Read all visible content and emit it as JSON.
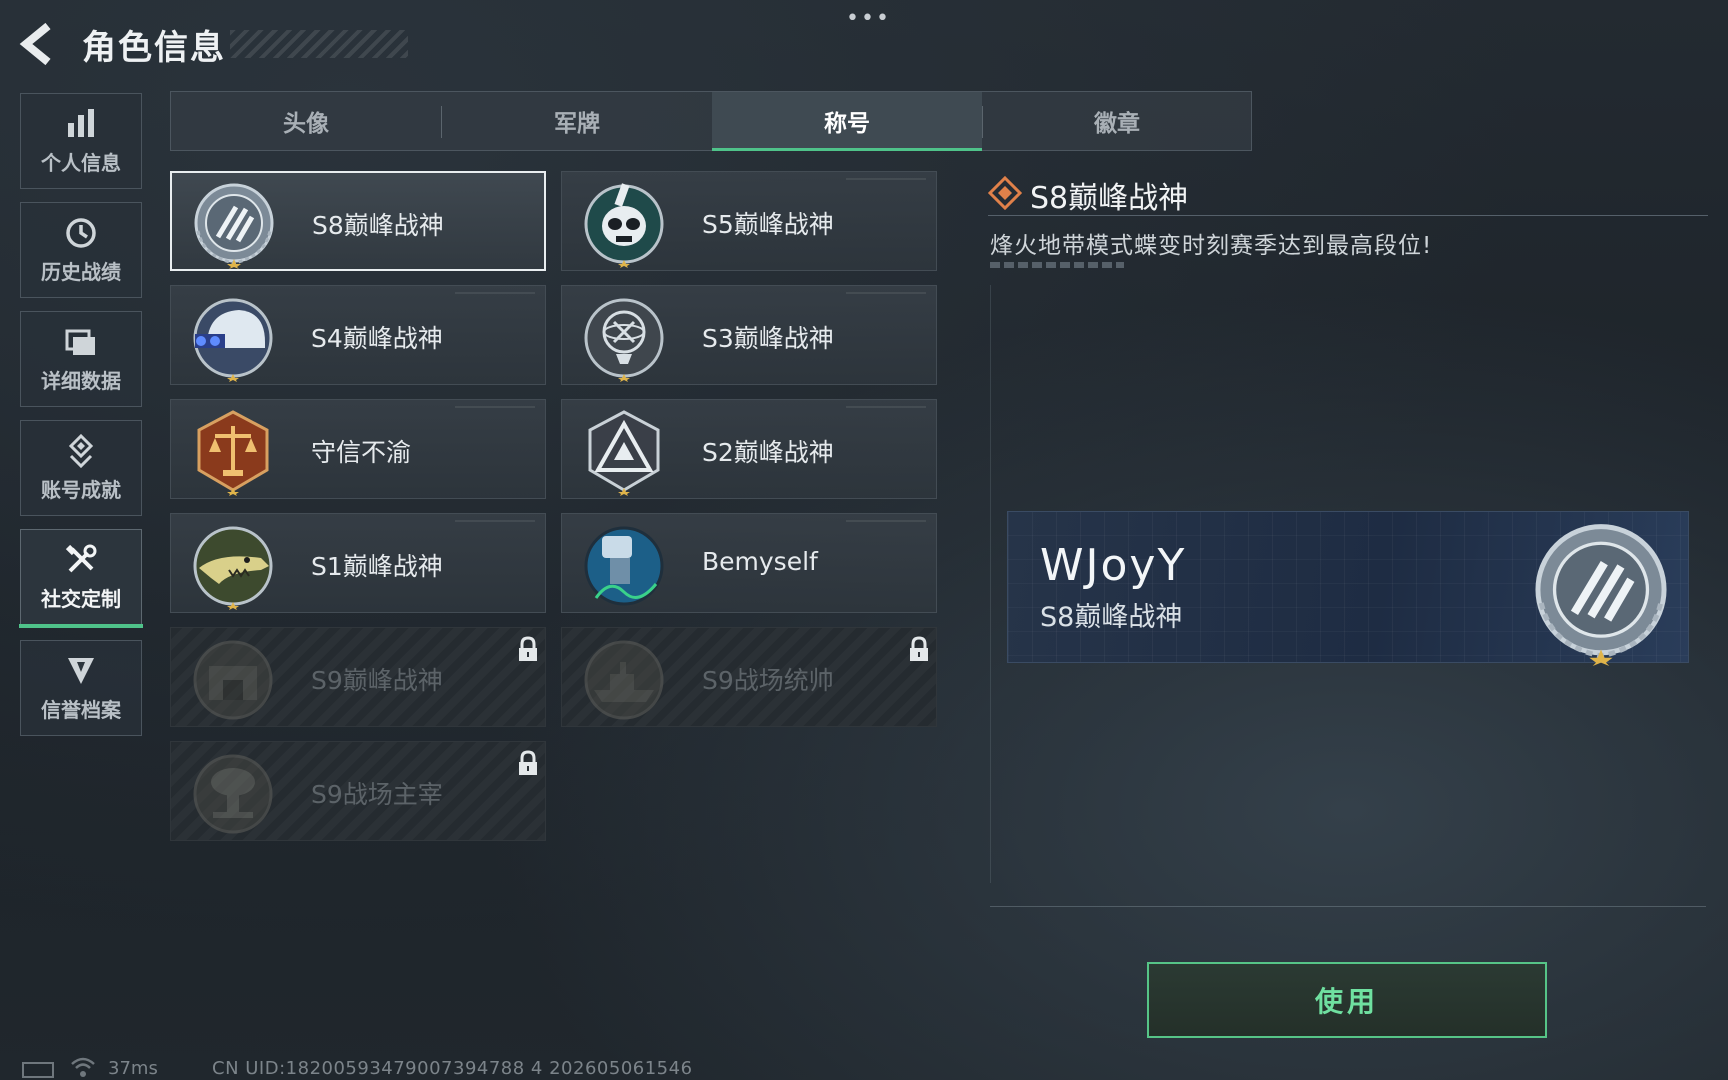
{
  "header": {
    "title": "角色信息",
    "more_glyph": "•••"
  },
  "sidebar": {
    "items": [
      {
        "label": "个人信息",
        "icon": "bar-chart-icon"
      },
      {
        "label": "历史战绩",
        "icon": "history-clock-icon"
      },
      {
        "label": "详细数据",
        "icon": "folder-icon"
      },
      {
        "label": "账号成就",
        "icon": "achievement-icon"
      },
      {
        "label": "社交定制",
        "icon": "tools-icon",
        "active": true
      },
      {
        "label": "信誉档案",
        "icon": "shield-icon"
      }
    ]
  },
  "tabs": [
    {
      "label": "头像"
    },
    {
      "label": "军牌"
    },
    {
      "label": "称号",
      "active": true
    },
    {
      "label": "徽章"
    }
  ],
  "titles": [
    {
      "label": "S8巅峰战神",
      "emblem": "s8-peak-emblem-icon",
      "selected": true,
      "locked": false
    },
    {
      "label": "S5巅峰战神",
      "emblem": "s5-skull-emblem-icon",
      "selected": false,
      "locked": false
    },
    {
      "label": "S4巅峰战神",
      "emblem": "s4-helmet-emblem-icon",
      "selected": false,
      "locked": false
    },
    {
      "label": "S3巅峰战神",
      "emblem": "s3-globe-emblem-icon",
      "selected": false,
      "locked": false
    },
    {
      "label": "守信不渝",
      "emblem": "scales-emblem-icon",
      "selected": false,
      "locked": false
    },
    {
      "label": "S2巅峰战神",
      "emblem": "s2-triangle-emblem-icon",
      "selected": false,
      "locked": false
    },
    {
      "label": "S1巅峰战神",
      "emblem": "s1-crocodile-emblem-icon",
      "selected": false,
      "locked": false
    },
    {
      "label": "Bemyself",
      "emblem": "bemyself-emblem-icon",
      "selected": false,
      "locked": false
    },
    {
      "label": "S9巅峰战神",
      "emblem": "s9-fortress-emblem-icon",
      "selected": false,
      "locked": true
    },
    {
      "label": "S9战场统帅",
      "emblem": "s9-warship-emblem-icon",
      "selected": false,
      "locked": true
    },
    {
      "label": "S9战场主宰",
      "emblem": "s9-mushroom-cloud-emblem-icon",
      "selected": false,
      "locked": true
    }
  ],
  "detail": {
    "title": "S8巅峰战神",
    "description": "烽火地带模式蝶变时刻赛季达到最高段位!",
    "preview_name": "WJoyY",
    "preview_title": "S8巅峰战神"
  },
  "actions": {
    "use_label": "使用"
  },
  "footer": {
    "ping": "37ms",
    "uid": "CN UID:18200593479007394788 4 202605061546"
  },
  "colors": {
    "accent_green": "#4fc38a",
    "button_text": "#6fe0a0",
    "detail_icon": "#e0814a",
    "preview_bg": "#1e2c43"
  }
}
